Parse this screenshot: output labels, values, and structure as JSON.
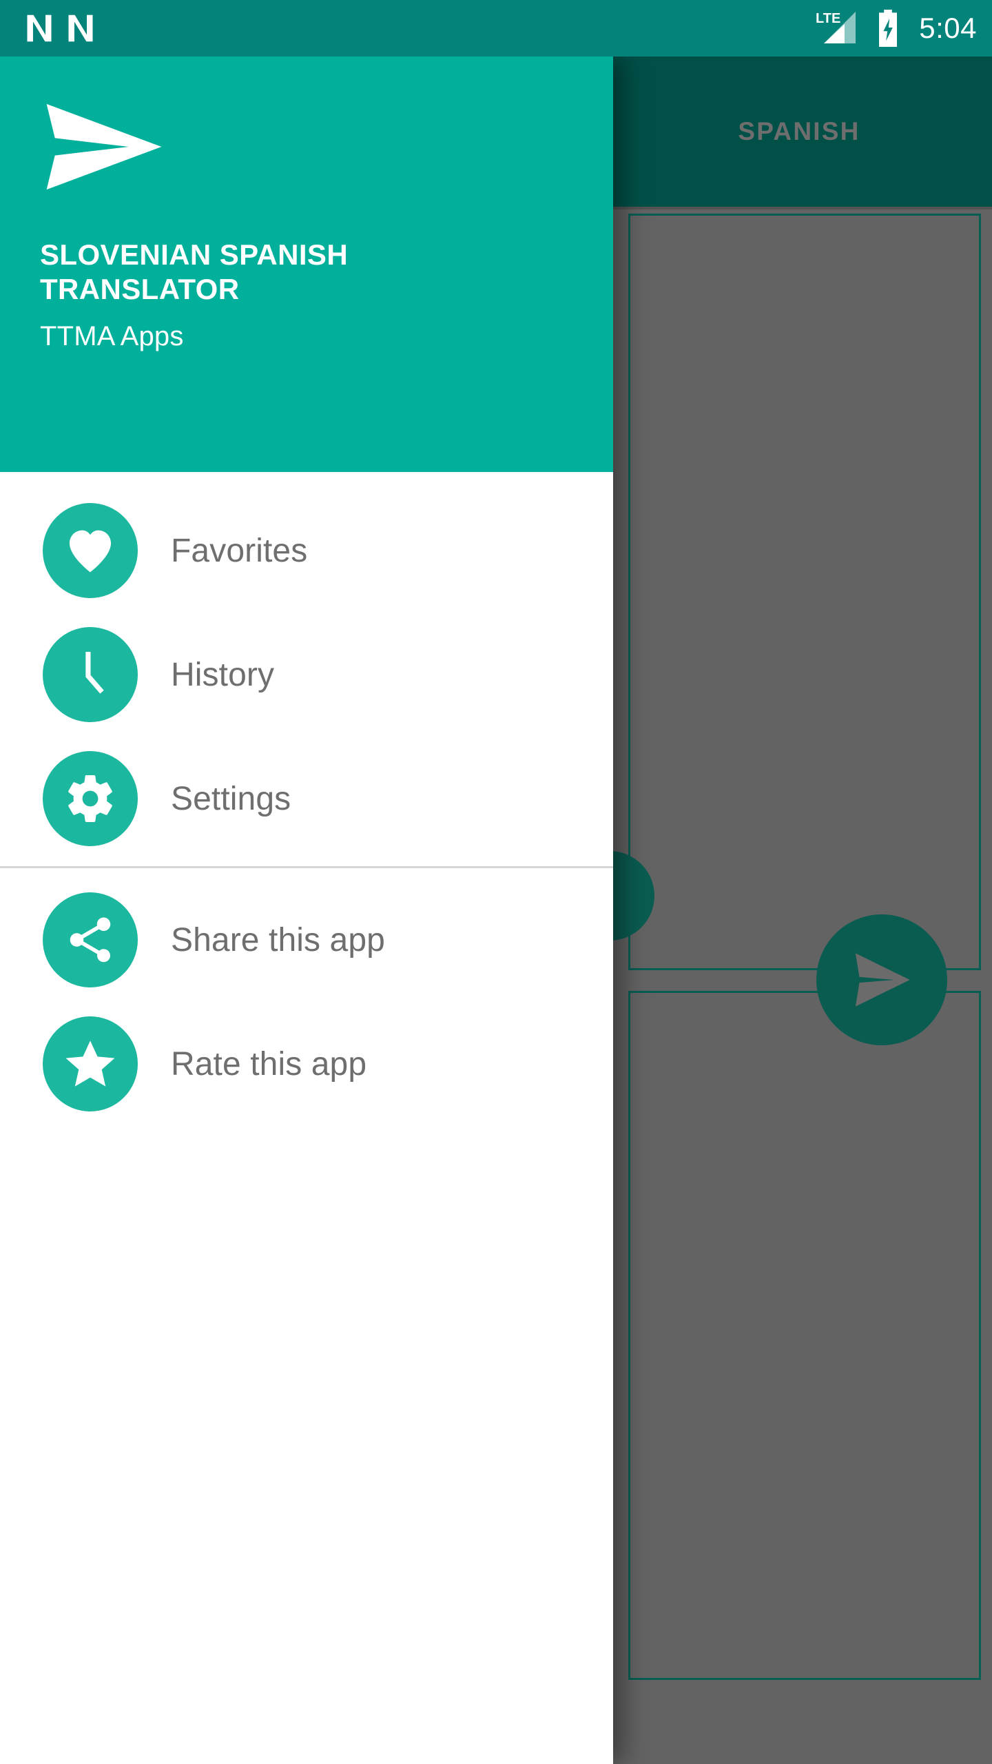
{
  "status_bar": {
    "time": "5:04",
    "network_label": "LTE",
    "icons": [
      "android-n-icon",
      "android-n-icon",
      "lte-signal-icon",
      "battery-charging-icon"
    ],
    "background_color": "#04837a"
  },
  "background": {
    "app_bar_color": "#015048",
    "tabs": [
      {
        "label": "SPANISH",
        "selected": true
      }
    ],
    "cards": [
      {
        "border_color": "#075e53"
      },
      {
        "border_color": "#075e53"
      }
    ],
    "fab": {
      "icon": "send-icon",
      "color": "#0a5c51"
    },
    "scrim_color": "#636363"
  },
  "drawer": {
    "header": {
      "logo_icon": "send-paper-plane-logo",
      "app_title": "SLOVENIAN SPANISH TRANSLATOR",
      "developer": "TTMA Apps",
      "background_color": "#00b09b"
    },
    "accent_color": "#1bb79e",
    "groups": [
      {
        "items": [
          {
            "label": "Favorites",
            "icon": "heart-icon"
          },
          {
            "label": "History",
            "icon": "clock-icon"
          },
          {
            "label": "Settings",
            "icon": "gear-icon"
          }
        ]
      },
      {
        "items": [
          {
            "label": "Share this app",
            "icon": "share-icon"
          },
          {
            "label": "Rate this app",
            "icon": "star-icon"
          }
        ]
      }
    ]
  }
}
